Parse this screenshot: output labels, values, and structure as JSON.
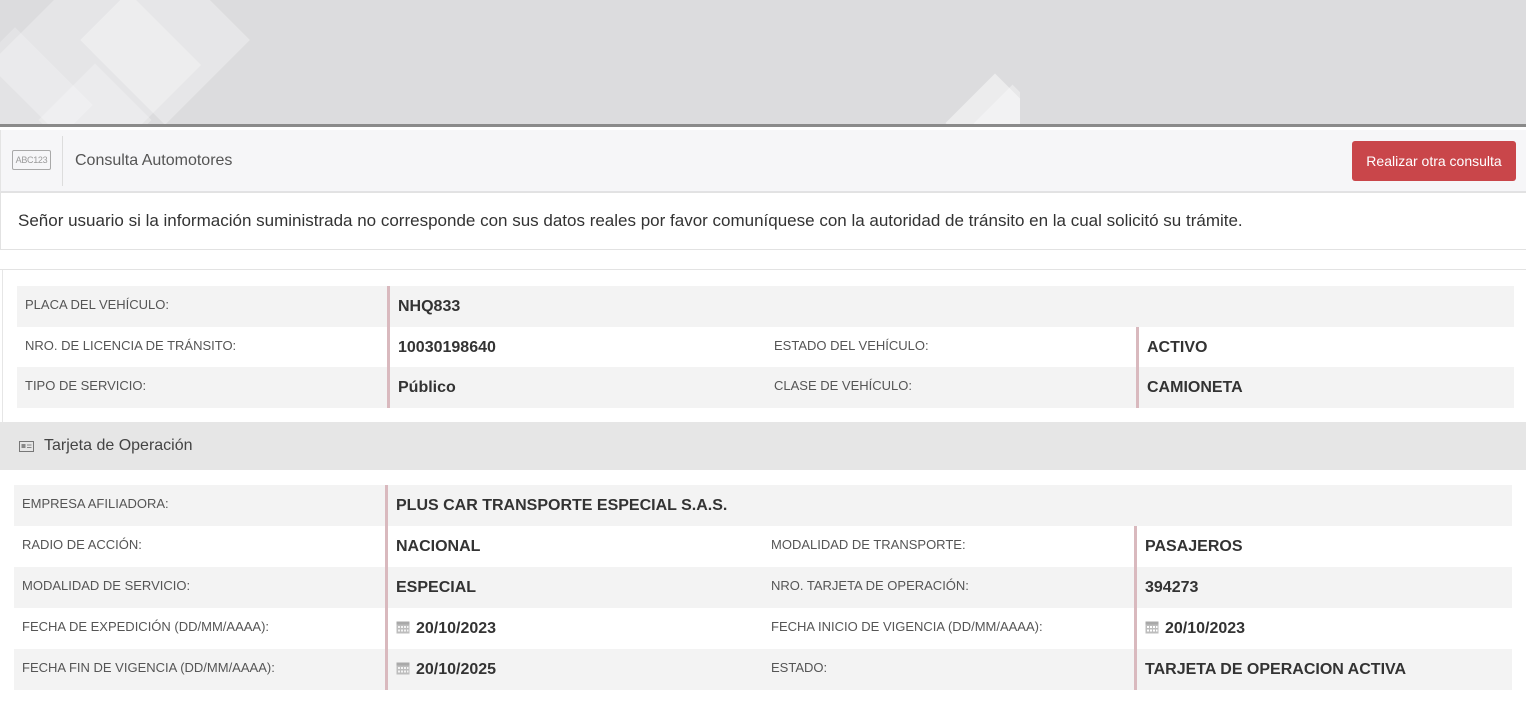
{
  "header": {
    "plate_icon_text": "ABC123",
    "title": "Consulta Automotores",
    "new_query_button": "Realizar otra consulta",
    "button_color": "#c9464a"
  },
  "notice": "Señor usuario si la información suministrada no corresponde con sus datos reales por favor comuníquese con la autoridad de tránsito en la cual solicitó su trámite.",
  "vehicle": {
    "plate": {
      "label": "PLACA DEL VEHÍCULO:",
      "value": "NHQ833"
    },
    "license": {
      "label": "NRO. DE LICENCIA DE TRÁNSITO:",
      "value": "10030198640"
    },
    "status": {
      "label": "ESTADO DEL VEHÍCULO:",
      "value": "ACTIVO"
    },
    "service_type": {
      "label": "TIPO DE SERVICIO:",
      "value": "Público"
    },
    "vehicle_class": {
      "label": "CLASE DE VEHÍCULO:",
      "value": "CAMIONETA"
    }
  },
  "operation_card": {
    "section_title": "Tarjeta de Operación",
    "company": {
      "label": "EMPRESA AFILIADORA:",
      "value": "PLUS CAR TRANSPORTE ESPECIAL S.A.S."
    },
    "action_radius": {
      "label": "RADIO DE ACCIÓN:",
      "value": "NACIONAL"
    },
    "transport_mode": {
      "label": "MODALIDAD DE TRANSPORTE:",
      "value": "PASAJEROS"
    },
    "service_mode": {
      "label": "MODALIDAD DE SERVICIO:",
      "value": "ESPECIAL"
    },
    "card_number": {
      "label": "NRO. TARJETA DE OPERACIÓN:",
      "value": "394273"
    },
    "issue_date": {
      "label": "FECHA DE EXPEDICIÓN (DD/MM/AAAA):",
      "value": "20/10/2023"
    },
    "validity_start": {
      "label": "FECHA INICIO DE VIGENCIA (DD/MM/AAAA):",
      "value": "20/10/2023"
    },
    "validity_end": {
      "label": "FECHA FIN DE VIGENCIA (DD/MM/AAAA):",
      "value": "20/10/2025"
    },
    "card_status": {
      "label": "ESTADO:",
      "value": "TARJETA DE OPERACION ACTIVA"
    }
  }
}
